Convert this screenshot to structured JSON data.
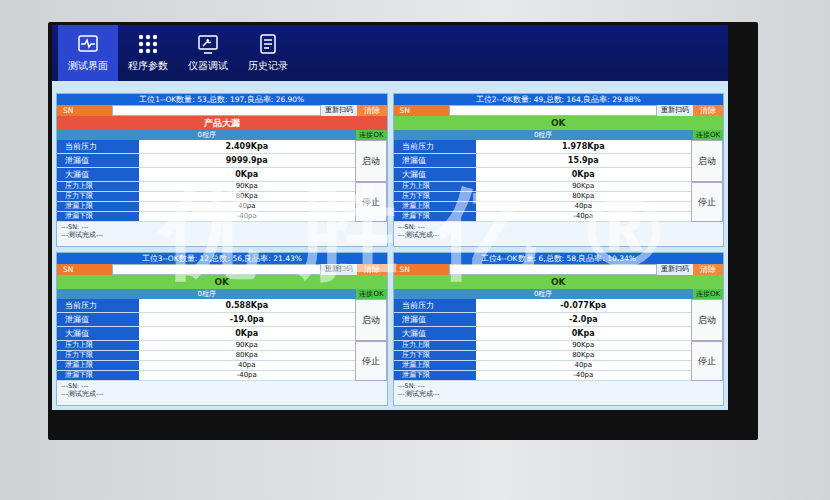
{
  "toolbar": {
    "tabs": [
      {
        "label": "测试界面",
        "selected": true,
        "icon": "wave"
      },
      {
        "label": "程序参数",
        "selected": false,
        "icon": "grid"
      },
      {
        "label": "仪器调试",
        "selected": false,
        "icon": "tool"
      },
      {
        "label": "历史记录",
        "selected": false,
        "icon": "doc"
      }
    ]
  },
  "stations": [
    {
      "header": "工位1--OK数量: 53,总数: 197,良品率: 26.90%",
      "sn_label": "SN",
      "rescan": "重新扫码",
      "clear": "清除",
      "status": {
        "text": "产品大漏",
        "kind": "fail",
        "color": "#e8533f"
      },
      "program": "0程序",
      "connection": "连接OK",
      "readings": [
        {
          "label": "当前压力",
          "value": "2.409Kpa"
        },
        {
          "label": "泄漏值",
          "value": "9999.9pa"
        },
        {
          "label": "大漏值",
          "value": "0Kpa"
        }
      ],
      "limits": [
        {
          "label": "压力上限",
          "value": "90Kpa"
        },
        {
          "label": "压力下限",
          "value": "80Kpa"
        },
        {
          "label": "泄漏上限",
          "value": "40pa"
        },
        {
          "label": "泄漏下限",
          "value": "-40pa"
        }
      ],
      "start": "启动",
      "stop": "停止",
      "log": [
        "---SN: ---",
        "---测试完成---"
      ]
    },
    {
      "header": "工位2--OK数量: 49,总数: 164,良品率: 29.88%",
      "sn_label": "SN",
      "rescan": "重新扫码",
      "clear": "清除",
      "status": {
        "text": "OK",
        "kind": "ok",
        "color": "#6fd04b"
      },
      "program": "0程序",
      "connection": "连接OK",
      "readings": [
        {
          "label": "当前压力",
          "value": "1.978Kpa"
        },
        {
          "label": "泄漏值",
          "value": "15.9pa"
        },
        {
          "label": "大漏值",
          "value": "0Kpa"
        }
      ],
      "limits": [
        {
          "label": "压力上限",
          "value": "90Kpa"
        },
        {
          "label": "压力下限",
          "value": "80Kpa"
        },
        {
          "label": "泄漏上限",
          "value": "40pa"
        },
        {
          "label": "泄漏下限",
          "value": "-40pa"
        }
      ],
      "start": "启动",
      "stop": "停止",
      "log": [
        "---SN: ---",
        "---测试完成---"
      ]
    },
    {
      "header": "工位3--OK数量: 12,总数: 56,良品率: 21.43%",
      "sn_label": "SN",
      "rescan": "重新扫码",
      "clear": "清除",
      "status": {
        "text": "OK",
        "kind": "ok",
        "color": "#6fd04b"
      },
      "program": "0程序",
      "connection": "连接OK",
      "readings": [
        {
          "label": "当前压力",
          "value": "0.588Kpa"
        },
        {
          "label": "泄漏值",
          "value": "-19.0pa"
        },
        {
          "label": "大漏值",
          "value": "0Kpa"
        }
      ],
      "limits": [
        {
          "label": "压力上限",
          "value": "90Kpa"
        },
        {
          "label": "压力下限",
          "value": "80Kpa"
        },
        {
          "label": "泄漏上限",
          "value": "40pa"
        },
        {
          "label": "泄漏下限",
          "value": "-40pa"
        }
      ],
      "start": "启动",
      "stop": "停止",
      "log": [
        "---SN: ---",
        "---测试完成---"
      ]
    },
    {
      "header": "工位4--OK数量: 6,总数: 58,良品率: 10.34%",
      "sn_label": "SN",
      "rescan": "重新扫码",
      "clear": "清除",
      "status": {
        "text": "OK",
        "kind": "ok",
        "color": "#6fd04b"
      },
      "program": "0程序",
      "connection": "连接OK",
      "readings": [
        {
          "label": "当前压力",
          "value": "-0.077Kpa"
        },
        {
          "label": "泄漏值",
          "value": "-2.0pa"
        },
        {
          "label": "大漏值",
          "value": "0Kpa"
        }
      ],
      "limits": [
        {
          "label": "压力上限",
          "value": "90Kpa"
        },
        {
          "label": "压力下限",
          "value": "80Kpa"
        },
        {
          "label": "泄漏上限",
          "value": "40pa"
        },
        {
          "label": "泄漏下限",
          "value": "-40pa"
        }
      ],
      "start": "启动",
      "stop": "停止",
      "log": [
        "---SN: ---",
        "---测试完成---"
      ]
    }
  ],
  "watermark": "优胜亿®"
}
